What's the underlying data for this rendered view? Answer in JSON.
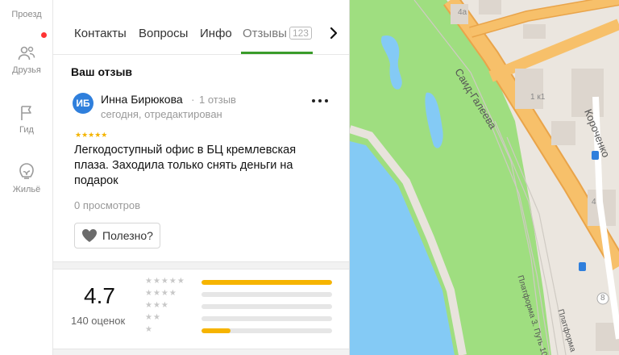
{
  "sidebar": {
    "items": [
      {
        "label": "Проезд"
      },
      {
        "label": "Друзья"
      },
      {
        "label": "Гид"
      },
      {
        "label": "Жильё"
      }
    ]
  },
  "tabs": {
    "items": [
      {
        "label": "Контакты"
      },
      {
        "label": "Вопросы"
      },
      {
        "label": "Инфо"
      },
      {
        "label": "Отзывы",
        "badge": "123"
      }
    ]
  },
  "review": {
    "section_title": "Ваш отзыв",
    "avatar_initials": "ИБ",
    "author": "Инна Бирюкова",
    "separator": "·",
    "author_reviews": "1 отзыв",
    "date": "сегодня, отредактирован",
    "stars": "★★★★★",
    "text": "Легкодоступный офис в БЦ кремлевская плаза. Заходила только снять деньги на подарок",
    "views": "0 просмотров",
    "useful_label": "Полезно?"
  },
  "rating": {
    "value": "4.7",
    "count_label": "140 оценок",
    "distribution": [
      {
        "stars": "★★★★★",
        "fraction": 1.0
      },
      {
        "stars": "★★★★",
        "fraction": 0.0
      },
      {
        "stars": "★★★",
        "fraction": 0.0
      },
      {
        "stars": "★★",
        "fraction": 0.0
      },
      {
        "stars": "★",
        "fraction": 0.22
      }
    ]
  },
  "map": {
    "labels": {
      "street1": "Саид-Галеева",
      "street2": "Короченко",
      "platform1": "Платформа 3. Путь 10",
      "platform2": "Платформа",
      "house_4a": "4а",
      "house_1k1": "1 к1",
      "house_4": "4",
      "house_8": "8"
    },
    "colors": {
      "land": "#ebe6df",
      "park": "#9fde80",
      "water": "#84caf5",
      "road": "#f7c06a"
    }
  },
  "colors": {
    "accent_green": "#3a9c2a",
    "star": "#f4b400",
    "avatar_blue": "#2f7fdc",
    "notif_red": "#ff3333"
  }
}
